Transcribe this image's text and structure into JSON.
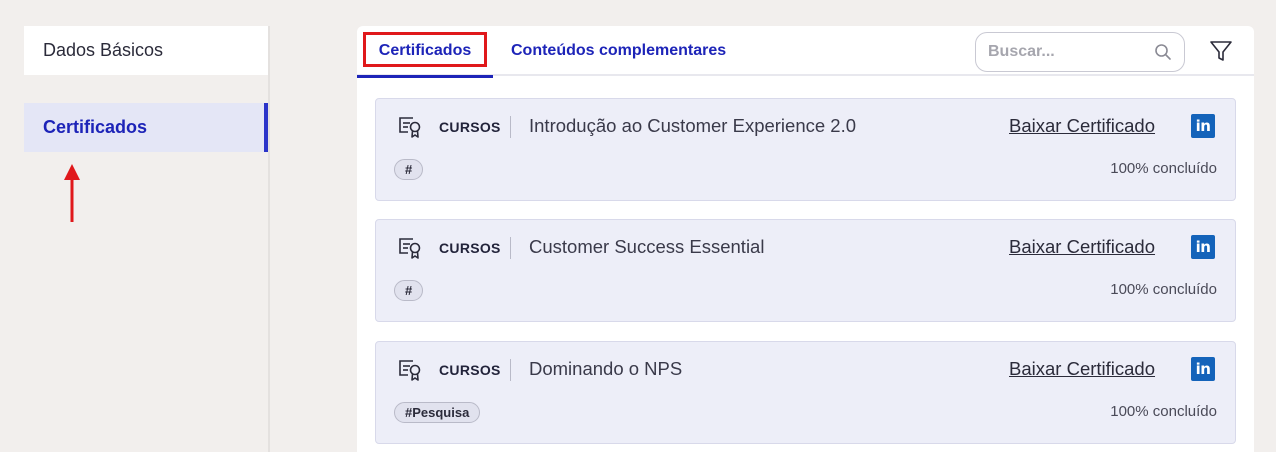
{
  "sidebar": {
    "items": [
      {
        "label": "Dados Básicos"
      },
      {
        "label": "Certificados"
      }
    ]
  },
  "tabs": {
    "items": [
      {
        "label": "Certificados",
        "active": true
      },
      {
        "label": "Conteúdos complementares",
        "active": false
      }
    ]
  },
  "search": {
    "placeholder": "Buscar...",
    "value": ""
  },
  "icons": {
    "search": "search-icon",
    "filter": "filter-icon",
    "certificate": "certificate-icon",
    "linkedin": "linkedin-icon"
  },
  "colors": {
    "accent": "#1d24b8",
    "highlight_box": "#e0181b",
    "card_bg": "#edeef8",
    "linkedin": "#1463ba"
  },
  "certificates": [
    {
      "type": "CURSOS",
      "title": "Introdução ao Customer Experience 2.0",
      "download_label": "Baixar Certificado",
      "linkedin_label": "in",
      "tag": "#",
      "progress": "100% concluído"
    },
    {
      "type": "CURSOS",
      "title": "Customer Success Essential",
      "download_label": "Baixar Certificado",
      "linkedin_label": "in",
      "tag": "#",
      "progress": "100% concluído"
    },
    {
      "type": "CURSOS",
      "title": "Dominando o NPS",
      "download_label": "Baixar Certificado",
      "linkedin_label": "in",
      "tag": "#Pesquisa",
      "progress": "100% concluído"
    }
  ]
}
